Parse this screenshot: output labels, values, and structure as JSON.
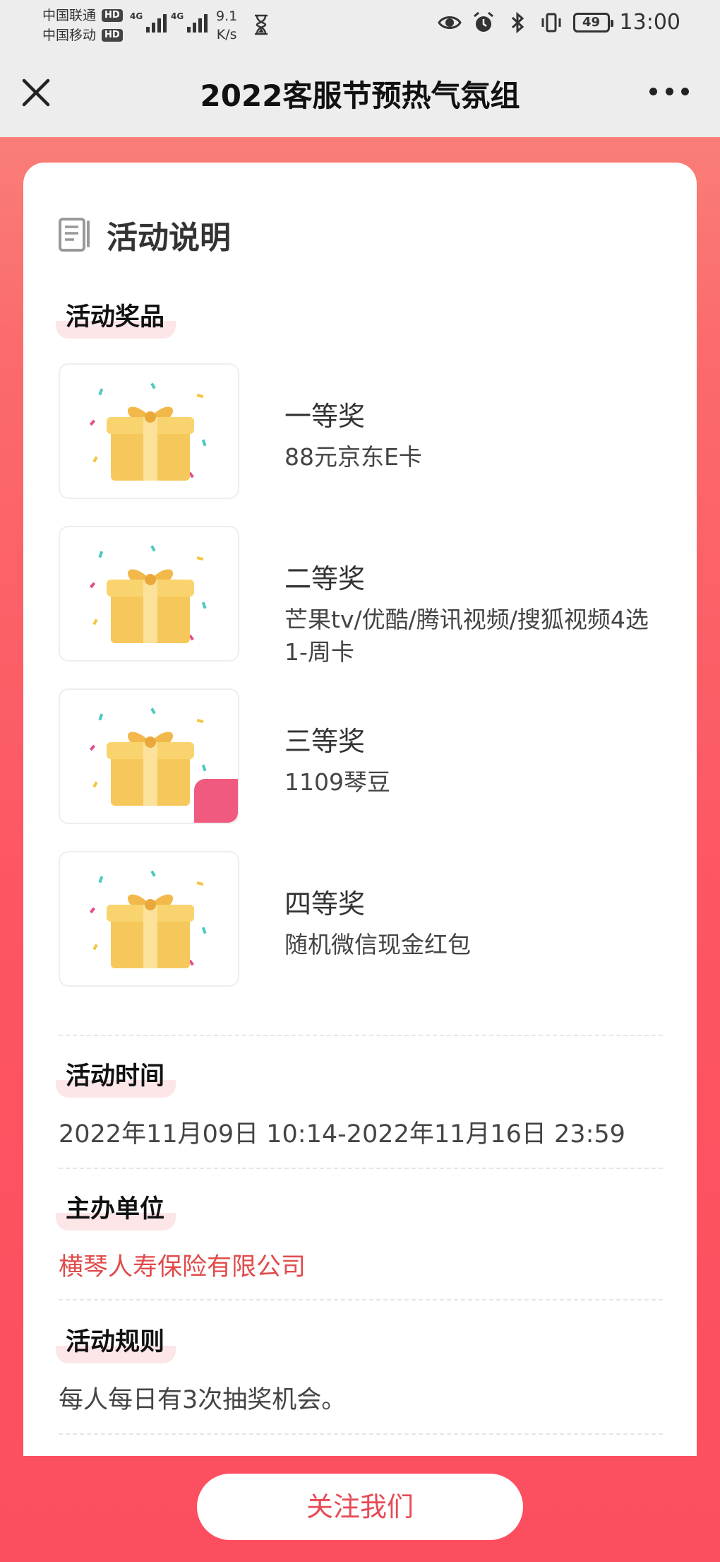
{
  "status_bar": {
    "carrier_1": "中国联通",
    "carrier_2": "中国移动",
    "hd_badge": "HD",
    "network_1": "4G",
    "network_2": "4G",
    "speed_value": "9.1",
    "speed_unit": "K/s",
    "battery": "49",
    "time": "13:00"
  },
  "header": {
    "title": "2022客服节预热气氛组"
  },
  "activity": {
    "section_title": "活动说明",
    "prizes_label": "活动奖品",
    "prizes": [
      {
        "name": "一等奖",
        "desc": "88元京东E卡"
      },
      {
        "name": "二等奖",
        "desc": "芒果tv/优酷/腾讯视频/搜狐视频4选1-周卡"
      },
      {
        "name": "三等奖",
        "desc": "1109琴豆"
      },
      {
        "name": "四等奖",
        "desc": "随机微信现金红包"
      }
    ],
    "time_label": "活动时间",
    "time_value": "2022年11月09日 10:14-2022年11月16日 23:59",
    "organizer_label": "主办单位",
    "organizer_value": "横琴人寿保险有限公司",
    "rules_label": "活动规则",
    "rules_value": "每人每日有3次抽奖机会。"
  },
  "footer": {
    "follow_button": "关注我们"
  },
  "colors": {
    "accent": "#e84a55",
    "organizer_text": "#e14b4b",
    "search_fab": "#f05a7e"
  }
}
